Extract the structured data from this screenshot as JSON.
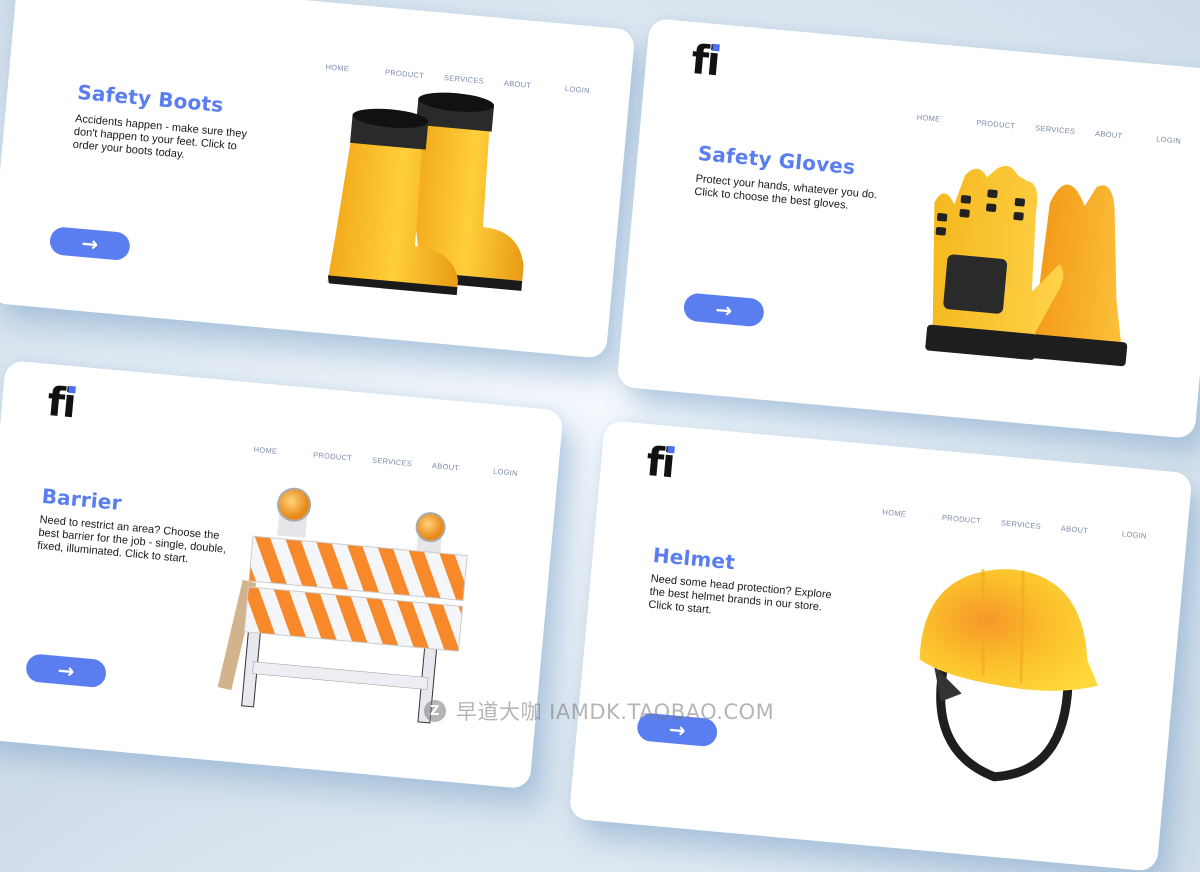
{
  "nav": {
    "items": [
      "HOME",
      "PRODUCT",
      "SERVICES",
      "ABOUT",
      "LOGIN"
    ]
  },
  "brand": {
    "logo_text": "fi",
    "accent": "#5a7ef0"
  },
  "cards": [
    {
      "title": "Safety Boots",
      "description": "Accidents happen - make sure they don't happen to your feet. Click to order your boots today.",
      "button_icon": "→",
      "product_image": "yellow-rubber-boots"
    },
    {
      "title": "Safety Gloves",
      "description": "Protect your hands, whatever you do. Click to choose the best gloves.",
      "button_icon": "→",
      "product_image": "yellow-work-gloves"
    },
    {
      "title": "Barrier",
      "description": "Need to restrict an area? Choose the best barrier for the job - single, double, fixed, illuminated. Click to start.",
      "button_icon": "→",
      "product_image": "striped-road-barrier-with-lamps"
    },
    {
      "title": "Helmet",
      "description": "Need some head protection? Explore the best helmet brands in our store. Click to start.",
      "button_icon": "→",
      "product_image": "yellow-hard-hat"
    }
  ],
  "watermark": {
    "icon": "Z",
    "text": "早道大咖  IAMDK.TAOBAO.COM"
  }
}
